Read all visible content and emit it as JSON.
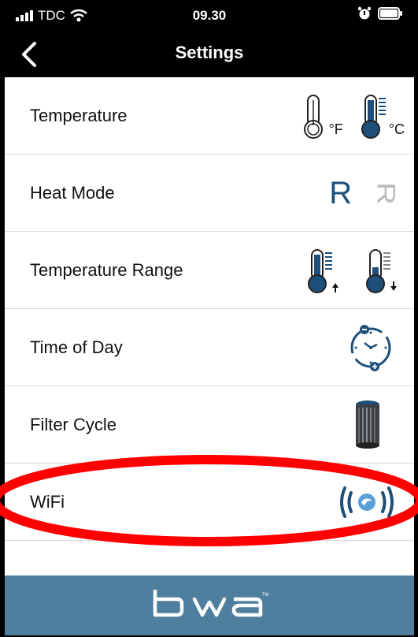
{
  "status": {
    "carrier": "TDC",
    "time": "09.30"
  },
  "nav": {
    "title": "Settings"
  },
  "settings": [
    {
      "label": "Temperature",
      "icons": [
        "thermometer-fahrenheit-icon",
        "thermometer-celsius-icon"
      ],
      "unit_f": "°F",
      "unit_c": "°C"
    },
    {
      "label": "Heat Mode",
      "icons": [
        "heat-mode-ready-icon",
        "heat-mode-rest-icon"
      ],
      "mode_ready": "R",
      "mode_rest": "R"
    },
    {
      "label": "Temperature Range",
      "icons": [
        "temperature-range-high-icon",
        "temperature-range-low-icon"
      ]
    },
    {
      "label": "Time of Day",
      "icons": [
        "clock-icon"
      ]
    },
    {
      "label": "Filter Cycle",
      "icons": [
        "filter-cartridge-icon"
      ]
    },
    {
      "label": "WiFi",
      "icons": [
        "wifi-signal-icon"
      ]
    }
  ],
  "footer": {
    "brand": "bwa",
    "brand_color": "#4f7f9f"
  },
  "colors": {
    "accent": "#1d4f7a",
    "highlight": "#ff0000"
  }
}
